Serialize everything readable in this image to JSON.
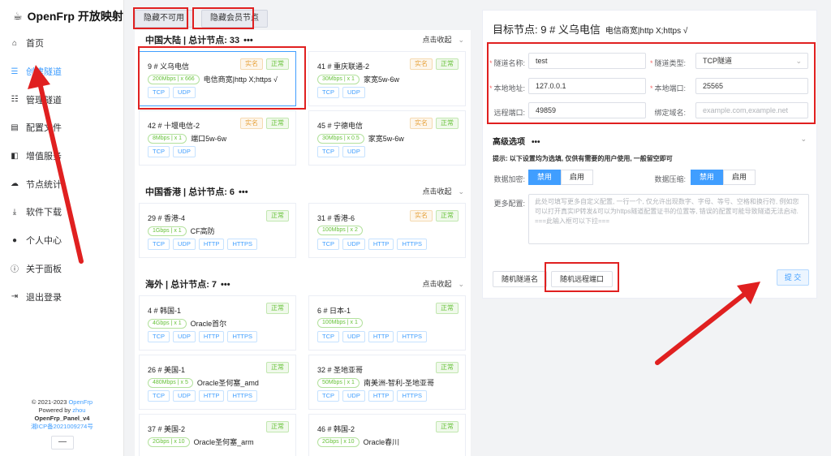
{
  "sidebar": {
    "brand": "OpenFrp 开放映射",
    "items": [
      {
        "label": "首页",
        "icon": "home-icon",
        "glyph": "⌂"
      },
      {
        "label": "创建隧道",
        "icon": "list-icon",
        "glyph": "☰",
        "active": true
      },
      {
        "label": "管理隧道",
        "icon": "manage-list-icon",
        "glyph": "☷"
      },
      {
        "label": "配置文件",
        "icon": "file-icon",
        "glyph": "▤"
      },
      {
        "label": "增值服务",
        "icon": "stack-icon",
        "glyph": "◧"
      },
      {
        "label": "节点统计",
        "icon": "cloud-icon",
        "glyph": "☁"
      },
      {
        "label": "软件下载",
        "icon": "download-icon",
        "glyph": "⤓"
      },
      {
        "label": "个人中心",
        "icon": "user-icon",
        "glyph": "●"
      },
      {
        "label": "关于面板",
        "icon": "info-icon",
        "glyph": "ⓘ"
      },
      {
        "label": "退出登录",
        "icon": "logout-icon",
        "glyph": "⇥"
      }
    ],
    "footer": {
      "copyright_prefix": "© 2021-2023 ",
      "copyright_link": "OpenFrp",
      "powered_prefix": "Powered by ",
      "powered_link": "zhou",
      "panel_version": "OpenFrp_Panel_v4",
      "icp": "湘ICP备2021009274号"
    },
    "collapse_label": "—"
  },
  "top_buttons": {
    "hide_unavailable": "隐藏不可用",
    "hide_member": "隐藏会员节点"
  },
  "groups": [
    {
      "name": "中国大陆 | 总计节点: 33",
      "collapse": "点击收起",
      "nodes": [
        {
          "title": "9 # 义乌电信",
          "badges": [
            "实名",
            "正常"
          ],
          "speed": "200Mbps | x 666",
          "note": "电信商宽|http X;https √",
          "protos": [
            "TCP",
            "UDP"
          ],
          "selected": true
        },
        {
          "title": "41 # 重庆联通-2",
          "badges": [
            "实名",
            "正常"
          ],
          "speed": "30Mbps | x 1",
          "note": "家宽5w-6w",
          "protos": [
            "TCP",
            "UDP"
          ]
        },
        {
          "title": "42 # 十堰电信-2",
          "badges": [
            "实名",
            "正常"
          ],
          "speed": "8Mbps | x 1",
          "note": "端口5w-6w",
          "protos": [
            "TCP",
            "UDP"
          ]
        },
        {
          "title": "45 # 宁德电信",
          "badges": [
            "实名",
            "正常"
          ],
          "speed": "30Mbps | x 0.5",
          "note": "家宽5w-6w",
          "protos": [
            "TCP",
            "UDP"
          ]
        }
      ]
    },
    {
      "name": "中国香港 | 总计节点: 6",
      "collapse": "点击收起",
      "nodes": [
        {
          "title": "29 # 香港-4",
          "badges": [
            "正常"
          ],
          "speed": "1Gbps | x 1",
          "note": "CF高防",
          "protos": [
            "TCP",
            "UDP",
            "HTTP",
            "HTTPS"
          ]
        },
        {
          "title": "31 # 香港-6",
          "badges": [
            "实名",
            "正常"
          ],
          "speed": "100Mbps | x 2",
          "note": "",
          "protos": [
            "TCP",
            "UDP",
            "HTTP",
            "HTTPS"
          ]
        }
      ]
    },
    {
      "name": "海外 | 总计节点: 7",
      "collapse": "点击收起",
      "nodes": [
        {
          "title": "4 # 韩国-1",
          "badges": [
            "正常"
          ],
          "speed": "4Gbps | x 1",
          "note": "Oracle首尔",
          "protos": [
            "TCP",
            "UDP",
            "HTTP",
            "HTTPS"
          ]
        },
        {
          "title": "6 # 日本-1",
          "badges": [
            "正常"
          ],
          "speed": "100Mbps | x 1",
          "note": "",
          "protos": [
            "TCP",
            "UDP",
            "HTTP",
            "HTTPS"
          ]
        },
        {
          "title": "26 # 美国-1",
          "badges": [
            "正常"
          ],
          "speed": "480Mbps | x 5",
          "note": "Oracle圣何塞_amd",
          "protos": [
            "TCP",
            "UDP",
            "HTTP",
            "HTTPS"
          ]
        },
        {
          "title": "32 # 圣地亚哥",
          "badges": [
            "正常"
          ],
          "speed": "50Mbps | x 1",
          "note": "南美洲-智利-圣地亚哥",
          "protos": [
            "TCP",
            "UDP",
            "HTTP",
            "HTTPS"
          ]
        },
        {
          "title": "37 # 美国-2",
          "badges": [
            "正常"
          ],
          "speed": "2Gbps | x 10",
          "note": "Oracle圣何塞_arm",
          "protos": []
        },
        {
          "title": "46 # 韩国-2",
          "badges": [
            "正常"
          ],
          "speed": "2Gbps | x 10",
          "note": "Oracle春川",
          "protos": []
        }
      ]
    }
  ],
  "form": {
    "title": "目标节点:  9 # 义乌电信",
    "subtitle": "电信商宽|http X;https √",
    "tunnel_name_label": "隧道名称:",
    "tunnel_name_value": "test",
    "tunnel_type_label": "隧道类型:",
    "tunnel_type_value": "TCP隧道",
    "local_addr_label": "本地地址:",
    "local_addr_value": "127.0.0.1",
    "local_port_label": "本地端口:",
    "local_port_value": "25565",
    "remote_port_label": "远程端口:",
    "remote_port_value": "49859",
    "domain_label": "绑定域名:",
    "domain_placeholder": "example.com,example.net",
    "advanced_title": "高级选项",
    "tip": "提示: 以下设置均为选填, 仅供有需要的用户使用, 一般留空即可",
    "encrypt_label": "数据加密:",
    "compress_label": "数据压缩:",
    "disable": "禁用",
    "enable": "启用",
    "more_label": "更多配置:",
    "more_placeholder": "此处可填写更多自定义配置, 一行一个, 仅允许出现数字、字母、等号、空格和换行符, 例如您可以打开真实IP转发&可以为https隧道配置证书的位置等, 错误的配置可能导致隧道无法启动. ===此输入框可以下拉===",
    "random_name": "随机隧道名",
    "random_port": "随机远程端口",
    "submit": "提 交"
  },
  "colors": {
    "accent": "#409eff",
    "ok": "#67c23a",
    "warn": "#e6a23c",
    "annotation": "#e02020"
  }
}
